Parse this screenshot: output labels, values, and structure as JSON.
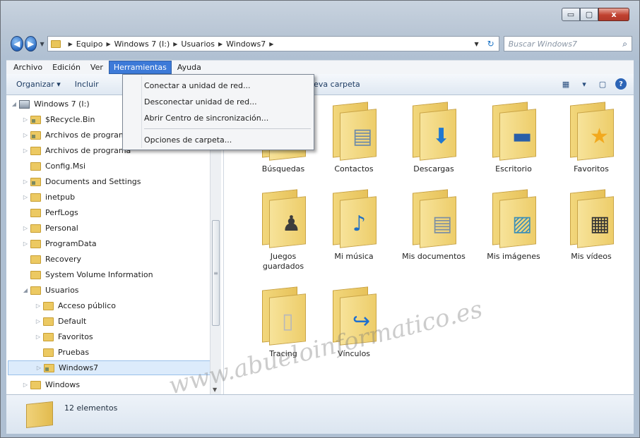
{
  "window": {
    "controls": {
      "minimize": "▭",
      "maximize": "▢",
      "close": "x"
    }
  },
  "address": {
    "breadcrumbs": [
      "Equipo",
      "Windows 7 (I:)",
      "Usuarios",
      "Windows7"
    ],
    "search_placeholder": "Buscar Windows7"
  },
  "menubar": {
    "items": [
      {
        "label": "Archivo",
        "active": false
      },
      {
        "label": "Edición",
        "active": false
      },
      {
        "label": "Ver",
        "active": false
      },
      {
        "label": "Herramientas",
        "active": true
      },
      {
        "label": "Ayuda",
        "active": false
      }
    ]
  },
  "toolbar": {
    "organize": "Organizar ▾",
    "include": "Incluir",
    "share_hidden": "ar",
    "new_folder": "Nueva carpeta"
  },
  "dropdown": {
    "items": [
      "Conectar a unidad de red...",
      "Desconectar unidad de red...",
      "Abrir Centro de sincronización...",
      "Opciones de carpeta..."
    ]
  },
  "tree": {
    "items": [
      {
        "label": "Windows 7 (I:)",
        "kind": "drive"
      },
      {
        "label": "$Recycle.Bin",
        "kind": "folder-locked"
      },
      {
        "label": "Archivos de programa",
        "kind": "folder-locked"
      },
      {
        "label": "Archivos de programa",
        "kind": "folder"
      },
      {
        "label": "Config.Msi",
        "kind": "folder"
      },
      {
        "label": "Documents and Settings",
        "kind": "folder-locked"
      },
      {
        "label": "inetpub",
        "kind": "folder"
      },
      {
        "label": "PerfLogs",
        "kind": "folder"
      },
      {
        "label": "Personal",
        "kind": "folder"
      },
      {
        "label": "ProgramData",
        "kind": "folder"
      },
      {
        "label": "Recovery",
        "kind": "folder"
      },
      {
        "label": "System Volume Information",
        "kind": "folder"
      },
      {
        "label": "Usuarios",
        "kind": "folder"
      },
      {
        "label": "Acceso público",
        "kind": "folder"
      },
      {
        "label": "Default",
        "kind": "folder"
      },
      {
        "label": "Favoritos",
        "kind": "folder"
      },
      {
        "label": "Pruebas",
        "kind": "folder"
      },
      {
        "label": "Windows7",
        "kind": "folder-locked"
      },
      {
        "label": "Windows",
        "kind": "folder"
      }
    ],
    "selected": "Windows7"
  },
  "files": [
    {
      "label": "Búsquedas",
      "emblem": "search-icon"
    },
    {
      "label": "Contactos",
      "emblem": "contact-card-icon"
    },
    {
      "label": "Descargas",
      "emblem": "download-arrow-icon"
    },
    {
      "label": "Escritorio",
      "emblem": "desktop-icon"
    },
    {
      "label": "Favoritos",
      "emblem": "star-icon"
    },
    {
      "label": "Juegos guardados",
      "emblem": "chess-pawn-icon"
    },
    {
      "label": "Mi música",
      "emblem": "music-note-icon"
    },
    {
      "label": "Mis documentos",
      "emblem": "document-icon"
    },
    {
      "label": "Mis imágenes",
      "emblem": "picture-icon"
    },
    {
      "label": "Mis vídeos",
      "emblem": "film-strip-icon"
    },
    {
      "label": "Tracing",
      "emblem": "blank-page-icon"
    },
    {
      "label": "Vínculos",
      "emblem": "link-arrow-icon"
    }
  ],
  "status": {
    "count": "12 elementos"
  },
  "watermark": "www.abueloinformatico.es"
}
